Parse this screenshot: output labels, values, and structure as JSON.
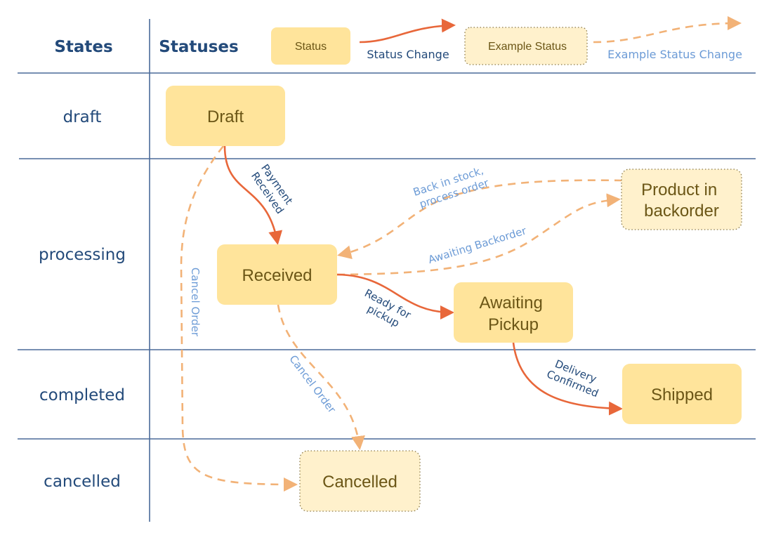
{
  "headers": {
    "states": "States",
    "statuses": "Statuses"
  },
  "legend": {
    "status": "Status",
    "status_change": "Status Change",
    "example_status": "Example Status",
    "example_status_change": "Example Status Change"
  },
  "lanes": [
    {
      "label": "draft"
    },
    {
      "label": "processing"
    },
    {
      "label": "completed"
    },
    {
      "label": "cancelled"
    }
  ],
  "nodes": {
    "draft": {
      "lines": [
        "Draft"
      ],
      "type": "status"
    },
    "received": {
      "lines": [
        "Received"
      ],
      "type": "status"
    },
    "awaiting_pickup": {
      "lines": [
        "Awaiting",
        "Pickup"
      ],
      "type": "status"
    },
    "product_in_backorder": {
      "lines": [
        "Product in",
        "backorder"
      ],
      "type": "example"
    },
    "shipped": {
      "lines": [
        "Shipped"
      ],
      "type": "status"
    },
    "cancelled": {
      "lines": [
        "Cancelled"
      ],
      "type": "example"
    }
  },
  "edges": [
    {
      "from": "draft",
      "to": "received",
      "style": "solid",
      "label": [
        "Payment",
        "Received"
      ]
    },
    {
      "from": "received",
      "to": "awaiting_pickup",
      "style": "solid",
      "label": [
        "Ready for",
        "pickup"
      ]
    },
    {
      "from": "awaiting_pickup",
      "to": "shipped",
      "style": "solid",
      "label": [
        "Delivery",
        "Confirmed"
      ]
    },
    {
      "from": "received",
      "to": "product_in_backorder",
      "style": "dashed",
      "label": [
        "Awaiting Backorder"
      ]
    },
    {
      "from": "product_in_backorder",
      "to": "received",
      "style": "dashed",
      "label": [
        "Back in stock,",
        "process order"
      ]
    },
    {
      "from": "received",
      "to": "cancelled",
      "style": "dashed",
      "label": [
        "Cancel Order"
      ]
    },
    {
      "from": "draft",
      "to": "cancelled",
      "style": "dashed",
      "label": [
        "Cancel Order"
      ]
    }
  ],
  "colors": {
    "status_fill": "#ffe49b",
    "example_fill": "#fff1cc",
    "status_change": "#e8673a",
    "example_status_change": "#f2b277",
    "header_text": "#234a7a",
    "example_label_text": "#6c9bd6",
    "node_text": "#6b5616"
  }
}
